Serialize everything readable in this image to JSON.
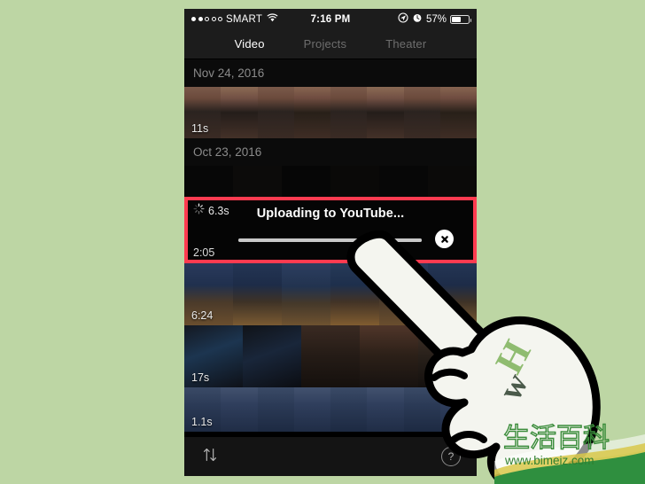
{
  "background_color": "#bdd6a4",
  "phone": {
    "status_bar": {
      "signal_dots": [
        true,
        true,
        false,
        false,
        false
      ],
      "carrier": "SMART",
      "wifi_icon": "wifi-icon",
      "time": "7:16 PM",
      "location_icon": "location-arrow-icon",
      "alarm_icon": "alarm-clock-icon",
      "battery_percent": "57%",
      "battery_level": 57
    },
    "tabs": [
      {
        "label": "Video",
        "active": true
      },
      {
        "label": "Projects",
        "active": false
      },
      {
        "label": "Theater",
        "active": false
      }
    ],
    "sections": [
      {
        "date": "Nov 24, 2016",
        "videos": [
          {
            "duration": "11s",
            "frames": 8,
            "thumb_style": "hands-holding-dark-objects"
          }
        ]
      },
      {
        "date": "Oct 23, 2016",
        "videos": [
          {
            "duration": "",
            "frames": 6,
            "thumb_style": "very-dark-scene"
          }
        ]
      }
    ],
    "upload_overlay": {
      "spinner_icon": "spinner-icon",
      "clip_duration": "6.3s",
      "title": "Uploading to YouTube...",
      "progress_percent": 100,
      "cancel_icon": "close-x-icon",
      "video_duration": "2:05",
      "highlight_color": "#ff3b50"
    },
    "videos_below": [
      {
        "duration": "6:24",
        "frames": 6,
        "thumb_style": "people-blue-shirts-eating"
      },
      {
        "duration": "17s",
        "frames": 5,
        "thumb_style": "dark-venue-crowd"
      },
      {
        "duration": "1.1s",
        "frames": 8,
        "thumb_style": "blue-crowd-filmstrip"
      }
    ],
    "toolbar": {
      "sort_icon": "sort-arrows-icon",
      "sort_label": "↑↓",
      "help_icon": "help-question-icon",
      "help_label": "?"
    }
  },
  "hand_cursor": {
    "logo_w": "w",
    "logo_h": "H",
    "logo_w_color": "#4a5a4a",
    "logo_h_color": "#8fbc70"
  },
  "watermark": {
    "chinese_text": "生活百科",
    "url": "www.bimeiz.com",
    "color": "#3a8c3a"
  }
}
